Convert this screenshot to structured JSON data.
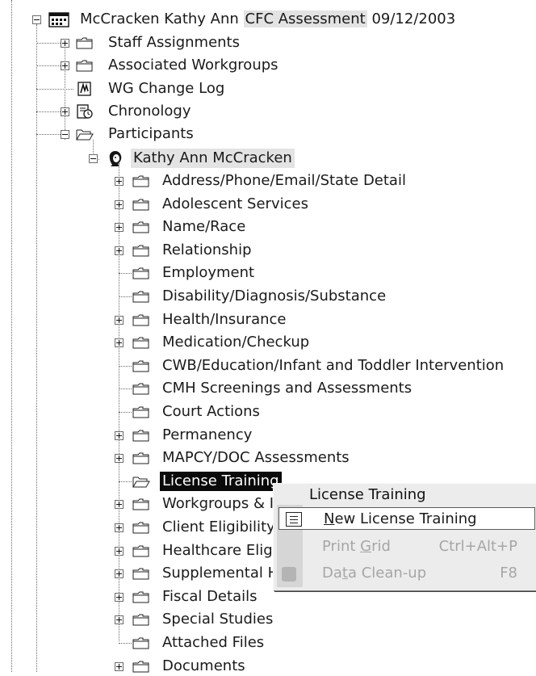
{
  "tree": {
    "root": {
      "name": "McCracken Kathy Ann",
      "assessment": "CFC Assessment",
      "date": "09/12/2003"
    },
    "level1": [
      {
        "label": "Staff Assignments",
        "icon": "folder-icon"
      },
      {
        "label": "Associated Workgroups",
        "icon": "folder-icon"
      },
      {
        "label": "WG Change Log",
        "icon": "change-log-icon"
      },
      {
        "label": "Chronology",
        "icon": "chronology-icon"
      },
      {
        "label": "Participants",
        "icon": "folder-icon"
      }
    ],
    "participant": {
      "label": "Kathy Ann McCracken",
      "icon": "person-icon"
    },
    "participant_children": [
      "Address/Phone/Email/State Detail",
      "Adolescent Services",
      "Name/Race",
      "Relationship",
      "Employment",
      "Disability/Diagnosis/Substance",
      "Health/Insurance",
      "Medication/Checkup",
      "CWB/Education/Infant and Toddler Intervention",
      "CMH Screenings and Assessments",
      "Court Actions",
      "Permanency",
      "MAPCY/DOC Assessments",
      "License Training",
      "Workgroups & I",
      "Client Eligibility I",
      "Healthcare Eligil",
      "Supplemental H",
      "Fiscal Details",
      "Special Studies",
      "Attached Files",
      "Documents"
    ],
    "selected": "License Training"
  },
  "context_menu": {
    "title": "License Training",
    "items": [
      {
        "label": "New License Training",
        "shortcut": "",
        "enabled": true
      },
      {
        "label": "Print Grid",
        "shortcut": "Ctrl+Alt+P",
        "enabled": false
      },
      {
        "label": "Data Clean-up",
        "shortcut": "F8",
        "enabled": false
      }
    ]
  },
  "colors": {
    "selection": "#0a0a0a",
    "shaded": "#e3e3e3",
    "menu_bg": "#ececec",
    "disabled": "#a6a6a6"
  }
}
